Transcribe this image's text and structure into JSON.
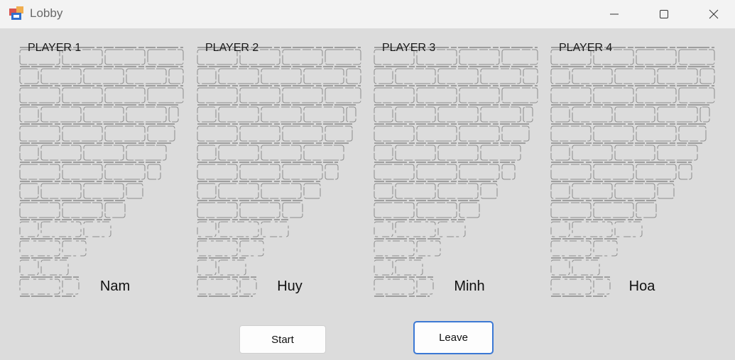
{
  "window": {
    "title": "Lobby",
    "controls": [
      "minimize-icon",
      "maximize-icon",
      "close-icon"
    ]
  },
  "players": [
    {
      "label": "PLAYER 1",
      "name": "Nam"
    },
    {
      "label": "PLAYER 2",
      "name": "Huy"
    },
    {
      "label": "PLAYER 3",
      "name": "Minh"
    },
    {
      "label": "PLAYER 4",
      "name": "Hoa"
    }
  ],
  "buttons": {
    "start": "Start",
    "leave": "Leave"
  },
  "colors": {
    "background": "#dcdcdc",
    "titlebar": "#f3f3f3",
    "accent_border": "#3b78d4"
  }
}
